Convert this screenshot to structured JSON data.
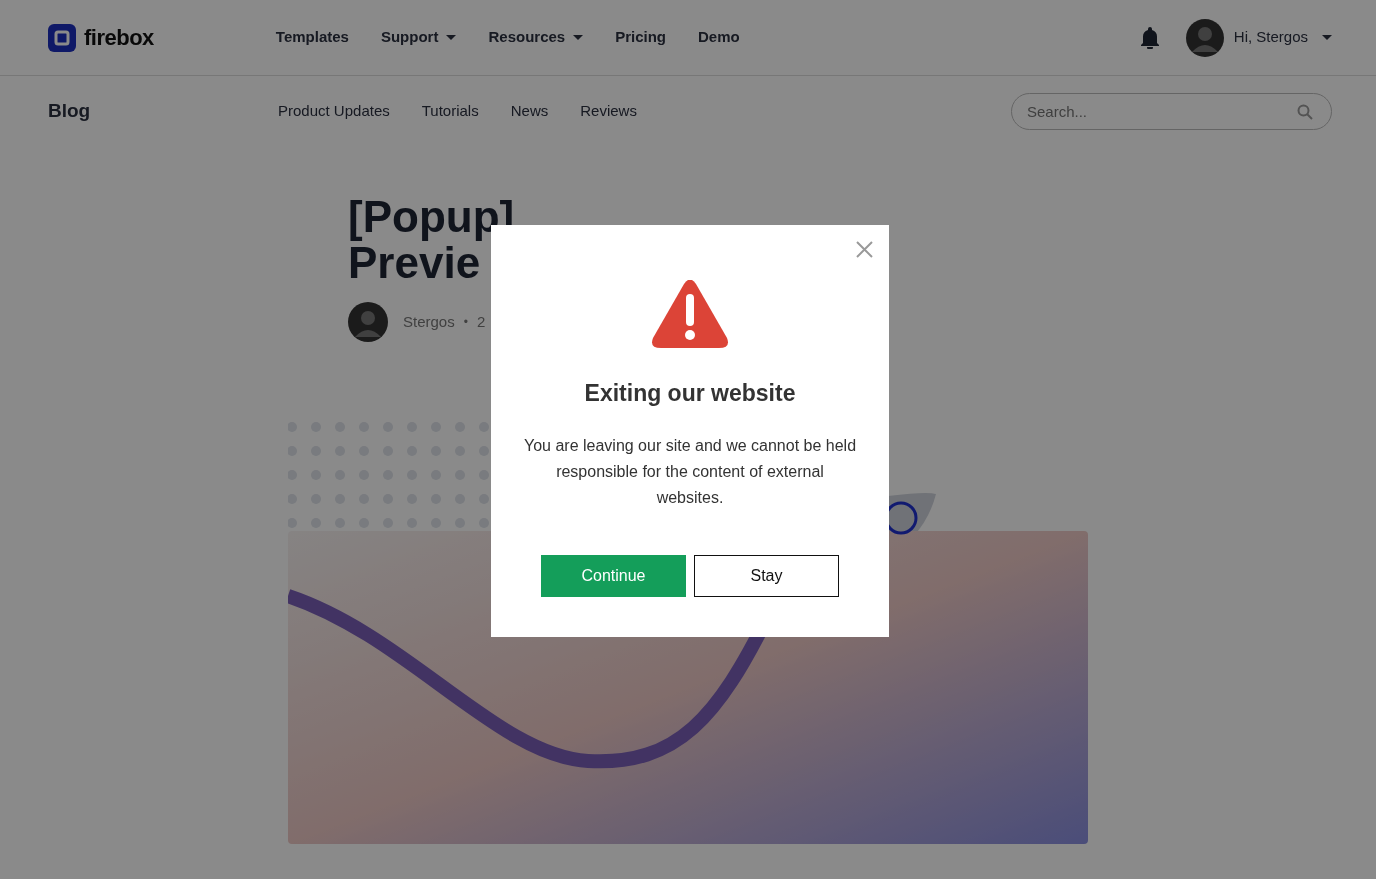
{
  "header": {
    "logo": "firebox",
    "nav": [
      {
        "label": "Templates",
        "dropdown": false
      },
      {
        "label": "Support",
        "dropdown": true
      },
      {
        "label": "Resources",
        "dropdown": true
      },
      {
        "label": "Pricing",
        "dropdown": false
      },
      {
        "label": "Demo",
        "dropdown": false
      }
    ],
    "user": {
      "greeting": "Hi, Stergos"
    }
  },
  "subnav": {
    "title": "Blog",
    "links": [
      "Product Updates",
      "Tutorials",
      "News",
      "Reviews"
    ],
    "search": {
      "placeholder": "Search..."
    }
  },
  "article": {
    "title_lines": [
      "[Popup]",
      "Previe"
    ],
    "author": "Stergos",
    "separator": "•",
    "date": "2"
  },
  "modal": {
    "title": "Exiting our website",
    "message": "You are leaving our site and we cannot be held responsible for the content of external websites.",
    "buttons": [
      {
        "label": "Continue",
        "kind": "primary"
      },
      {
        "label": "Stay",
        "kind": "outline"
      }
    ]
  }
}
